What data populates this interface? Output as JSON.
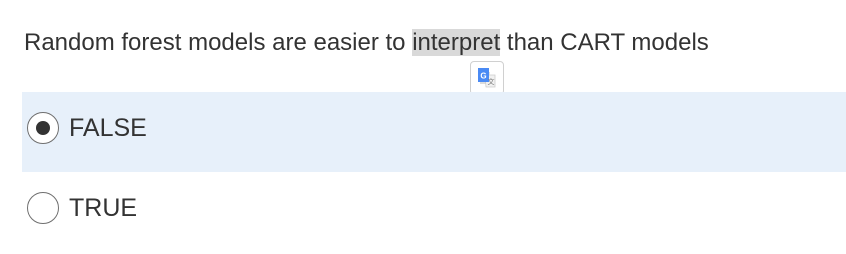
{
  "question": {
    "before": "Random forest models are easier to ",
    "highlight": "interpret",
    "after": " than CART models"
  },
  "translate_popup": {
    "icon": "google-translate-icon",
    "glyph": "G"
  },
  "options": [
    {
      "label": "FALSE",
      "selected": true
    },
    {
      "label": "TRUE",
      "selected": false
    }
  ],
  "colors": {
    "selected_bg": "#e7f0fa",
    "highlight_bg": "#d9d9d9",
    "translate_blue": "#4a8af4"
  }
}
